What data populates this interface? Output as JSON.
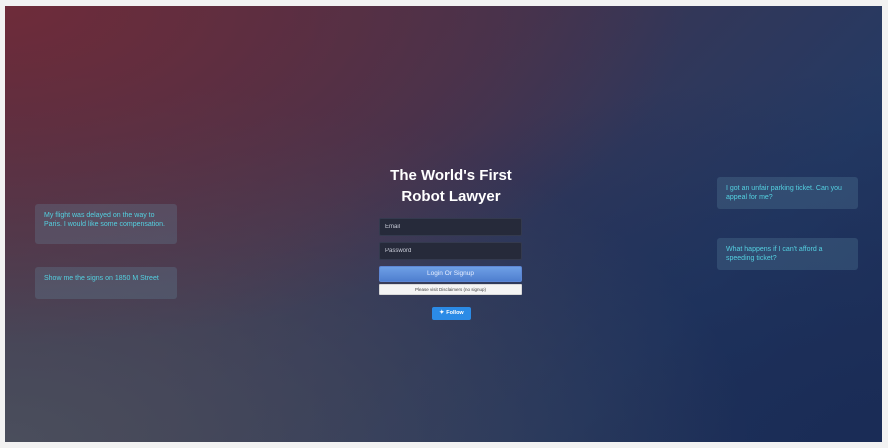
{
  "headline": {
    "line1": "The World's First",
    "line2": "Robot Lawyer"
  },
  "login_form": {
    "email_placeholder": "Email",
    "password_placeholder": "Password",
    "submit_label": "Login Or Signup",
    "disclaimer_label": "Please visit Disclaimers (no signup)"
  },
  "social": {
    "follow_label": "Follow",
    "follow_icon": "twitter-bird-icon"
  },
  "example_prompts": {
    "left": [
      "My flight was delayed on the way to Paris. I would like some compensation.",
      "Show me the signs on 1850 M Street"
    ],
    "right": [
      "I got an unfair parking ticket. Can you appeal for me?",
      "What happens if I can't afford a speeding ticket?"
    ]
  },
  "colors": {
    "prompt_text": "#54d0e0",
    "login_button": "#5b8bd8",
    "follow_button": "#2b8be6"
  }
}
